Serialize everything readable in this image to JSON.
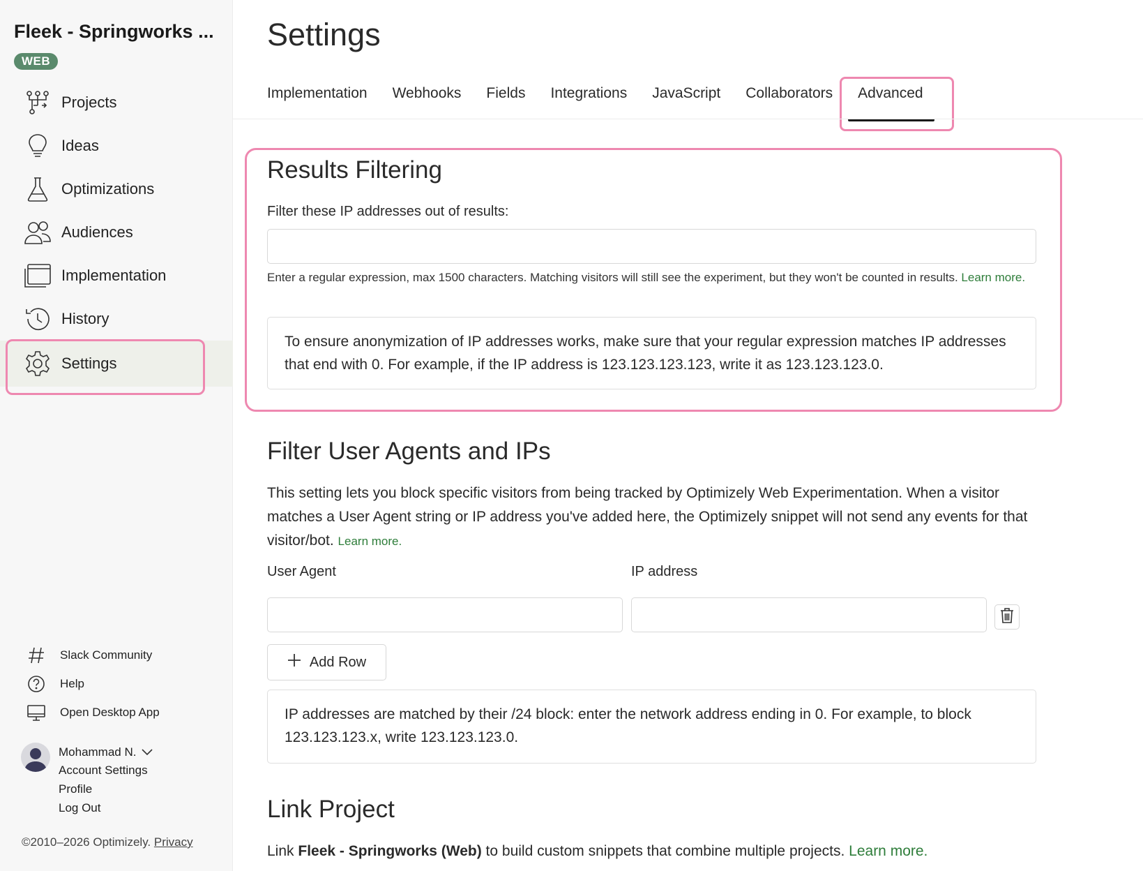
{
  "sidebar": {
    "project_title": "Fleek - Springworks ...",
    "badge": "WEB",
    "nav": [
      {
        "label": "Projects",
        "icon": "projects-icon"
      },
      {
        "label": "Ideas",
        "icon": "lightbulb-icon"
      },
      {
        "label": "Optimizations",
        "icon": "flask-icon"
      },
      {
        "label": "Audiences",
        "icon": "people-icon"
      },
      {
        "label": "Implementation",
        "icon": "window-stack-icon"
      },
      {
        "label": "History",
        "icon": "history-icon"
      },
      {
        "label": "Settings",
        "icon": "gear-icon",
        "active": true
      }
    ],
    "footer_links": [
      {
        "label": "Slack Community",
        "icon": "hash-icon"
      },
      {
        "label": "Help",
        "icon": "help-circle-icon"
      },
      {
        "label": "Open Desktop App",
        "icon": "monitor-icon"
      }
    ],
    "user": {
      "name": "Mohammad N.",
      "menu": [
        "Account Settings",
        "Profile",
        "Log Out"
      ]
    },
    "copyright": "©2010–2026 Optimizely.",
    "privacy": "Privacy"
  },
  "main": {
    "title": "Settings",
    "tabs": [
      "Implementation",
      "Webhooks",
      "Fields",
      "Integrations",
      "JavaScript",
      "Collaborators",
      "Advanced"
    ],
    "active_tab": "Advanced",
    "results_filtering": {
      "heading": "Results Filtering",
      "label": "Filter these IP addresses out of results:",
      "input_value": "",
      "helper": "Enter a regular expression, max 1500 characters. Matching visitors will still see the experiment, but they won't be counted in results.",
      "learn_more": "Learn more.",
      "note": "To ensure anonymization of IP addresses works, make sure that your regular expression matches IP addresses that end with 0. For example, if the IP address is 123.123.123.123, write it as 123.123.123.0."
    },
    "filter_agents": {
      "heading": "Filter User Agents and IPs",
      "description": "This setting lets you block specific visitors from being tracked by Optimizely Web Experimentation. When a visitor matches a User Agent string or IP address you've added here, the Optimizely snippet will not send any events for that visitor/bot.",
      "learn_more": "Learn more.",
      "user_agent_label": "User Agent",
      "ip_label": "IP address",
      "user_agent_value": "",
      "ip_value": "",
      "add_row": "Add Row",
      "note": "IP addresses are matched by their /24 block: enter the network address ending in 0. For example, to block 123.123.123.x, write 123.123.123.0."
    },
    "link_project": {
      "heading": "Link Project",
      "text_prefix": "Link",
      "project_name": "Fleek - Springworks (Web)",
      "text_suffix": "to build custom snippets that combine multiple projects.",
      "learn_more": "Learn more."
    }
  }
}
